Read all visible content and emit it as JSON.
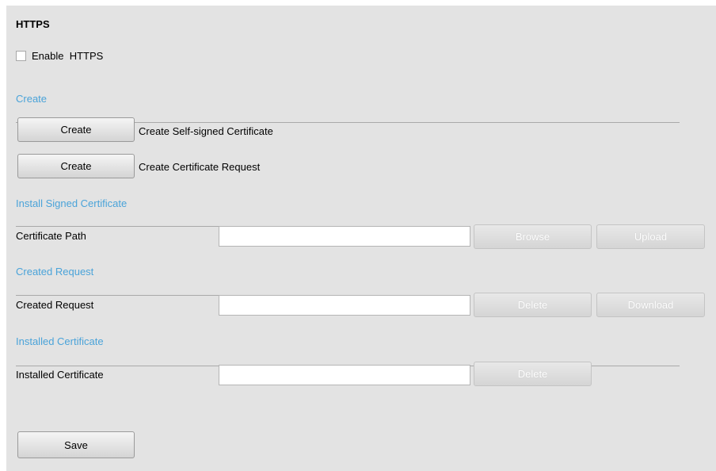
{
  "https": {
    "title": "HTTPS",
    "enable_label": "Enable  HTTPS",
    "enable_checked": false
  },
  "create_section": {
    "heading": "Create",
    "rows": [
      {
        "button": "Create",
        "label": "Create Self-signed Certificate"
      },
      {
        "button": "Create",
        "label": "Create Certificate Request"
      }
    ]
  },
  "install_section": {
    "heading": "Install Signed Certificate",
    "label": "Certificate Path",
    "value": "",
    "browse": "Browse",
    "upload": "Upload"
  },
  "request_section": {
    "heading": "Created Request",
    "label": "Created Request",
    "value": "",
    "delete": "Delete",
    "download": "Download"
  },
  "installed_section": {
    "heading": "Installed Certificate",
    "label": "Installed Certificate",
    "value": "",
    "delete": "Delete"
  },
  "save_label": "Save"
}
